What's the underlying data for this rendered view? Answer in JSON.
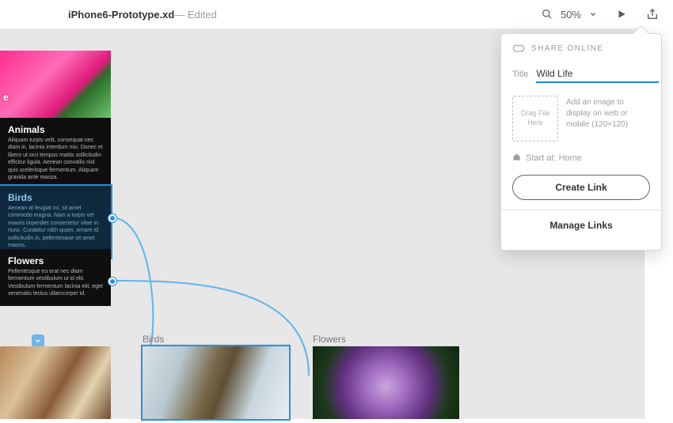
{
  "header": {
    "filename": "iPhone6-Prototype.xd",
    "edited_suffix": " — Edited",
    "zoom": "50%"
  },
  "hero": {
    "corner_label": "e"
  },
  "cards": {
    "animals": {
      "title": "Animals",
      "body": "Aliquam turpis velit, consequat nec diam in, lacinia interdum nisi. Donec et libero ut orci tempus mattis sollicitudin efficitur ligula. Aenean convallis nisl quis scelerisque fermentum. Aliquam gravida ante massa."
    },
    "birds": {
      "title": "Birds",
      "body": "Aenean at feugiat mi, sit amet commodo magna. Nam a turpis vel mauris imperdiet consectetur vitae in nunc. Curabitur nibh quam, ornare id sollicitudin in, pellentesque sit amet mauris."
    },
    "flowers": {
      "title": "Flowers",
      "body": "Pellentesque eu erat nec diam fermentum vestibulum ut id elit. Vestibulum fermentum lacinia elit, eget venenatis lectus ullamcorper id."
    }
  },
  "artboards": {
    "birds_label": "Birds",
    "flowers_label": "Flowers"
  },
  "share_panel": {
    "heading": "SHARE ONLINE",
    "title_label": "Title",
    "title_value": "Wild Life",
    "dropzone_text": "Drag File Here",
    "dropzone_help": "Add an image to display on web or mobile (120×120)",
    "start_at": "Start at: Home",
    "create_link": "Create Link",
    "manage_links": "Manage Links"
  },
  "icons": {
    "search": "search-icon",
    "chevron": "chevron-down-icon",
    "play": "play-icon",
    "share": "share-icon",
    "cc": "creative-cloud-icon",
    "home": "home-icon"
  }
}
